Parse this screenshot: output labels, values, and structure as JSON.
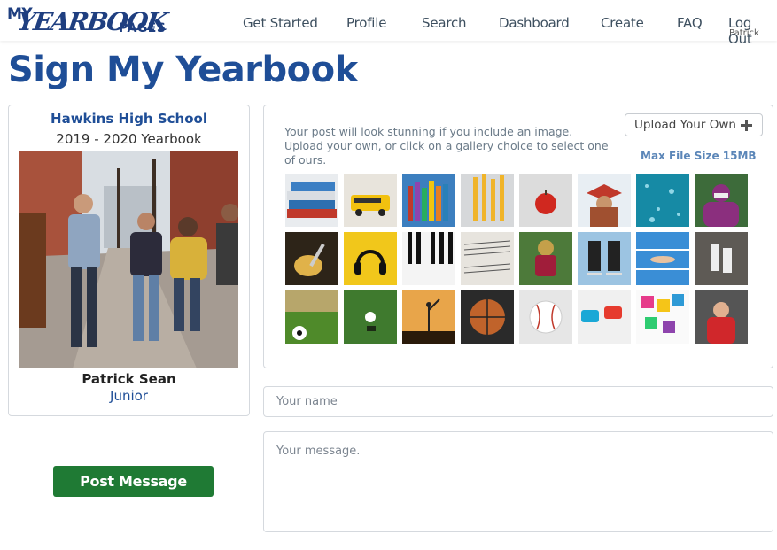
{
  "brand": {
    "logo_my": "MY",
    "logo_yearbook": "YEARBOOK",
    "logo_pages": "PAGES"
  },
  "nav": {
    "items": [
      "Get Started",
      "Profile",
      "Search",
      "Dashboard",
      "Create",
      "FAQ"
    ],
    "logout_label": "Log Out",
    "user": "Patrick"
  },
  "page": {
    "title": "Sign My Yearbook"
  },
  "student_card": {
    "school": "Hawkins High School",
    "yearbook": "2019 - 2020 Yearbook",
    "name": "Patrick Sean",
    "grade": "Junior"
  },
  "gallery": {
    "help_text": "Your post will look stunning if you include an image. Upload your own, or click on a gallery choice to select one of ours.",
    "upload_label": "Upload Your Own",
    "max_size": "Max File Size 15MB",
    "images": [
      "books",
      "school-bus",
      "crayons",
      "pencils",
      "apple",
      "graduate",
      "water-drops",
      "masked-person",
      "guitar",
      "headphones",
      "piano-keys",
      "sheet-music",
      "football-player",
      "hockey-skates",
      "swimmer",
      "ice-skates",
      "soccer-ball",
      "golf-ball",
      "ballet-dancer",
      "basketball",
      "baseball",
      "game-controller",
      "paint-colors",
      "red-hoodie"
    ]
  },
  "form": {
    "name_placeholder": "Your name",
    "name_value": "",
    "message_placeholder": "Your message.",
    "message_value": "",
    "submit_label": "Post Message"
  },
  "colors": {
    "brand_blue": "#1f4e97",
    "post_green": "#1f7a34",
    "border": "#d5d9de",
    "link_blue": "#5b86b8"
  }
}
